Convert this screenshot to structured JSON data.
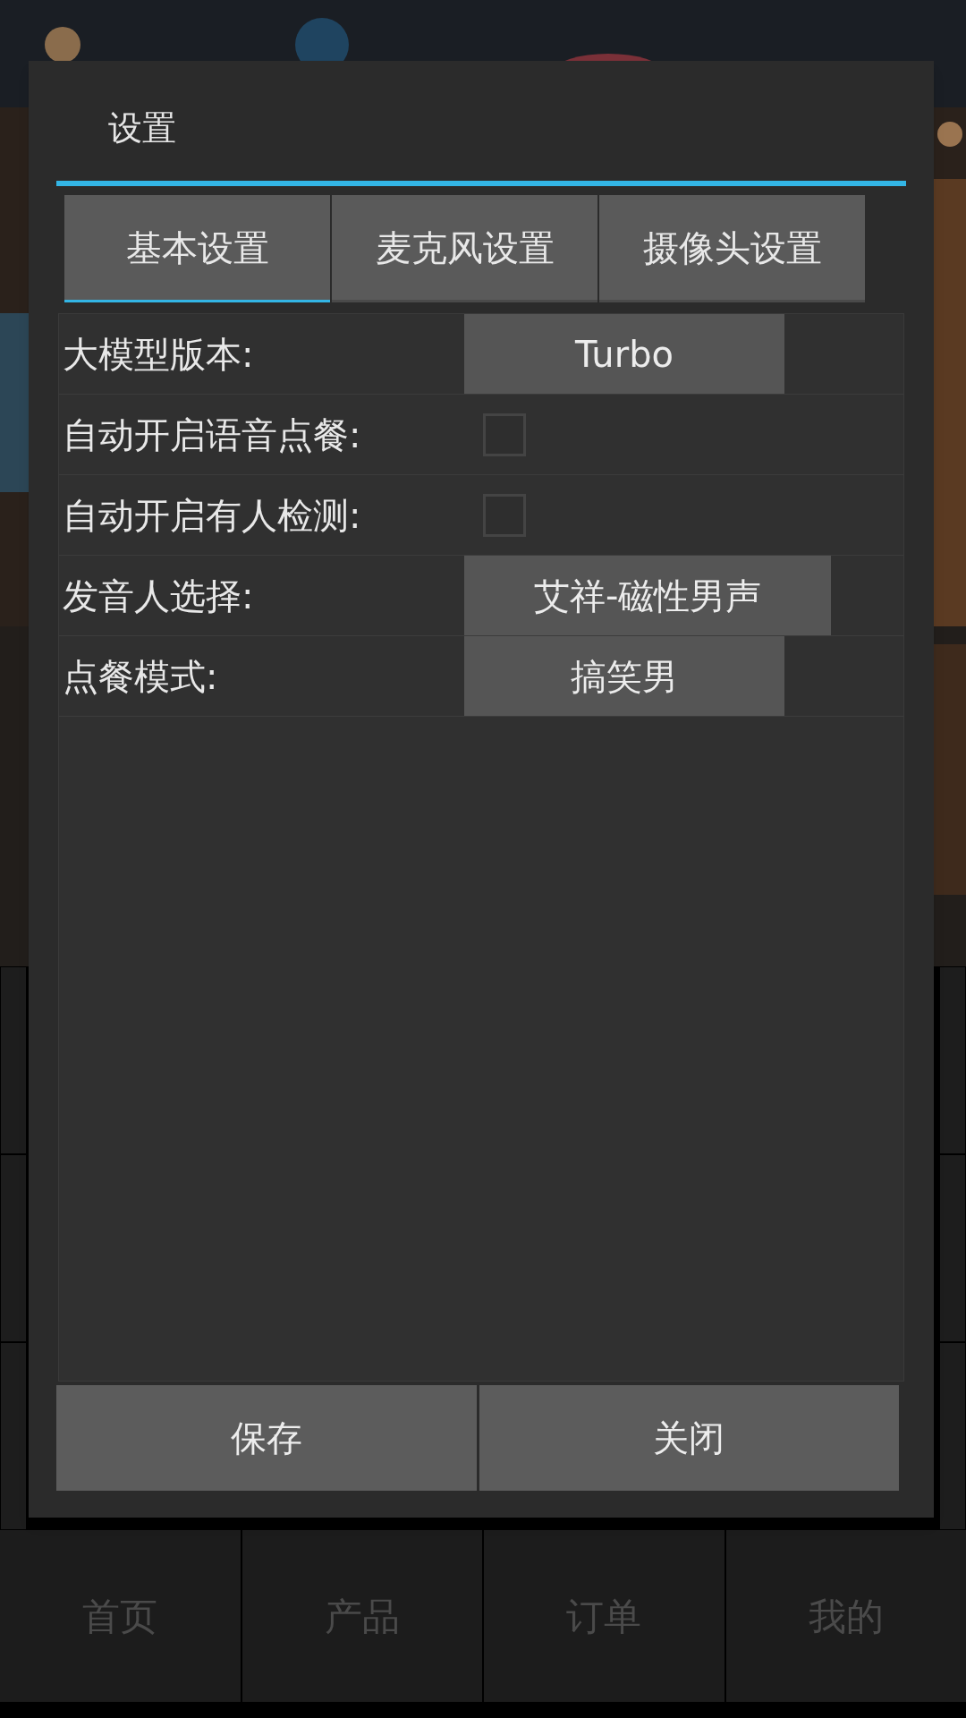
{
  "dialog": {
    "title": "设置",
    "tabs": [
      {
        "label": "基本设置",
        "selected": true
      },
      {
        "label": "麦克风设置",
        "selected": false
      },
      {
        "label": "摄像头设置",
        "selected": false
      }
    ],
    "rows": [
      {
        "kind": "select",
        "label": "大模型版本:",
        "value": "Turbo"
      },
      {
        "kind": "checkbox",
        "label": "自动开启语音点餐:",
        "checked": false
      },
      {
        "kind": "checkbox",
        "label": "自动开启有人检测:",
        "checked": false
      },
      {
        "kind": "select",
        "label": "发音人选择:",
        "value": "艾祥-磁性男声"
      },
      {
        "kind": "select",
        "label": "点餐模式:",
        "value": "搞笑男"
      }
    ],
    "buttons": [
      "保存",
      "关闭"
    ]
  },
  "bottom_nav": [
    {
      "label": "首页"
    },
    {
      "label": "产品"
    },
    {
      "label": "订单"
    },
    {
      "label": "我的"
    }
  ]
}
